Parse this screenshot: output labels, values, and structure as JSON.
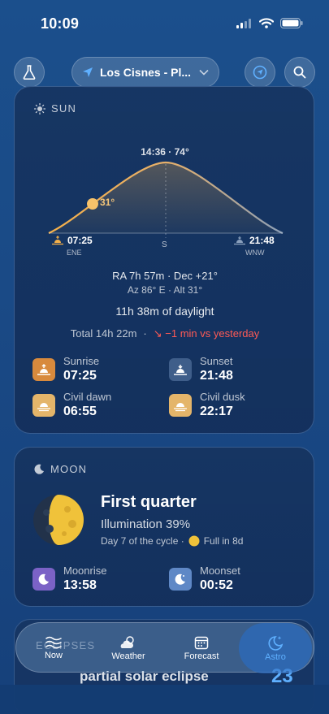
{
  "status_bar": {
    "time": "10:09"
  },
  "header": {
    "location": "Los Cisnes - Pl..."
  },
  "sun": {
    "title": "SUN",
    "peak_label": "14:36 · 74°",
    "current_altitude": "31°",
    "rise_time": "07:25",
    "rise_dir": "ENE",
    "set_time": "21:48",
    "set_dir": "WNW",
    "south_label": "S",
    "ra_dec": "RA 7h 57m · Dec +21°",
    "az_alt": "Az 86° E · Alt 31°",
    "daylight": "11h 38m of daylight",
    "total": "Total 14h 22m",
    "delta": "↘ −1 min vs yesterday",
    "events": [
      {
        "label": "Sunrise",
        "value": "07:25"
      },
      {
        "label": "Sunset",
        "value": "21:48"
      },
      {
        "label": "Civil dawn",
        "value": "06:55"
      },
      {
        "label": "Civil dusk",
        "value": "22:17"
      }
    ]
  },
  "moon": {
    "title": "MOON",
    "phase": "First quarter",
    "illumination": "Illumination 39%",
    "cycle": "Day 7 of the cycle ·",
    "full_in": "Full in 8d",
    "events": [
      {
        "label": "Moonrise",
        "value": "13:58"
      },
      {
        "label": "Moonset",
        "value": "00:52"
      }
    ]
  },
  "peek": {
    "section_title": "ECLIPSES",
    "item_text": "partial solar eclipse",
    "item_value": "23"
  },
  "tabs": [
    {
      "label": "Now",
      "icon": "waves-icon"
    },
    {
      "label": "Weather",
      "icon": "sun-cloud-icon"
    },
    {
      "label": "Forecast",
      "icon": "calendar-icon"
    },
    {
      "label": "Astro",
      "icon": "moon-stars-icon"
    }
  ],
  "colors": {
    "accent": "#3b8ff0",
    "sun": "#f5b049",
    "negative": "#ff5a55"
  }
}
